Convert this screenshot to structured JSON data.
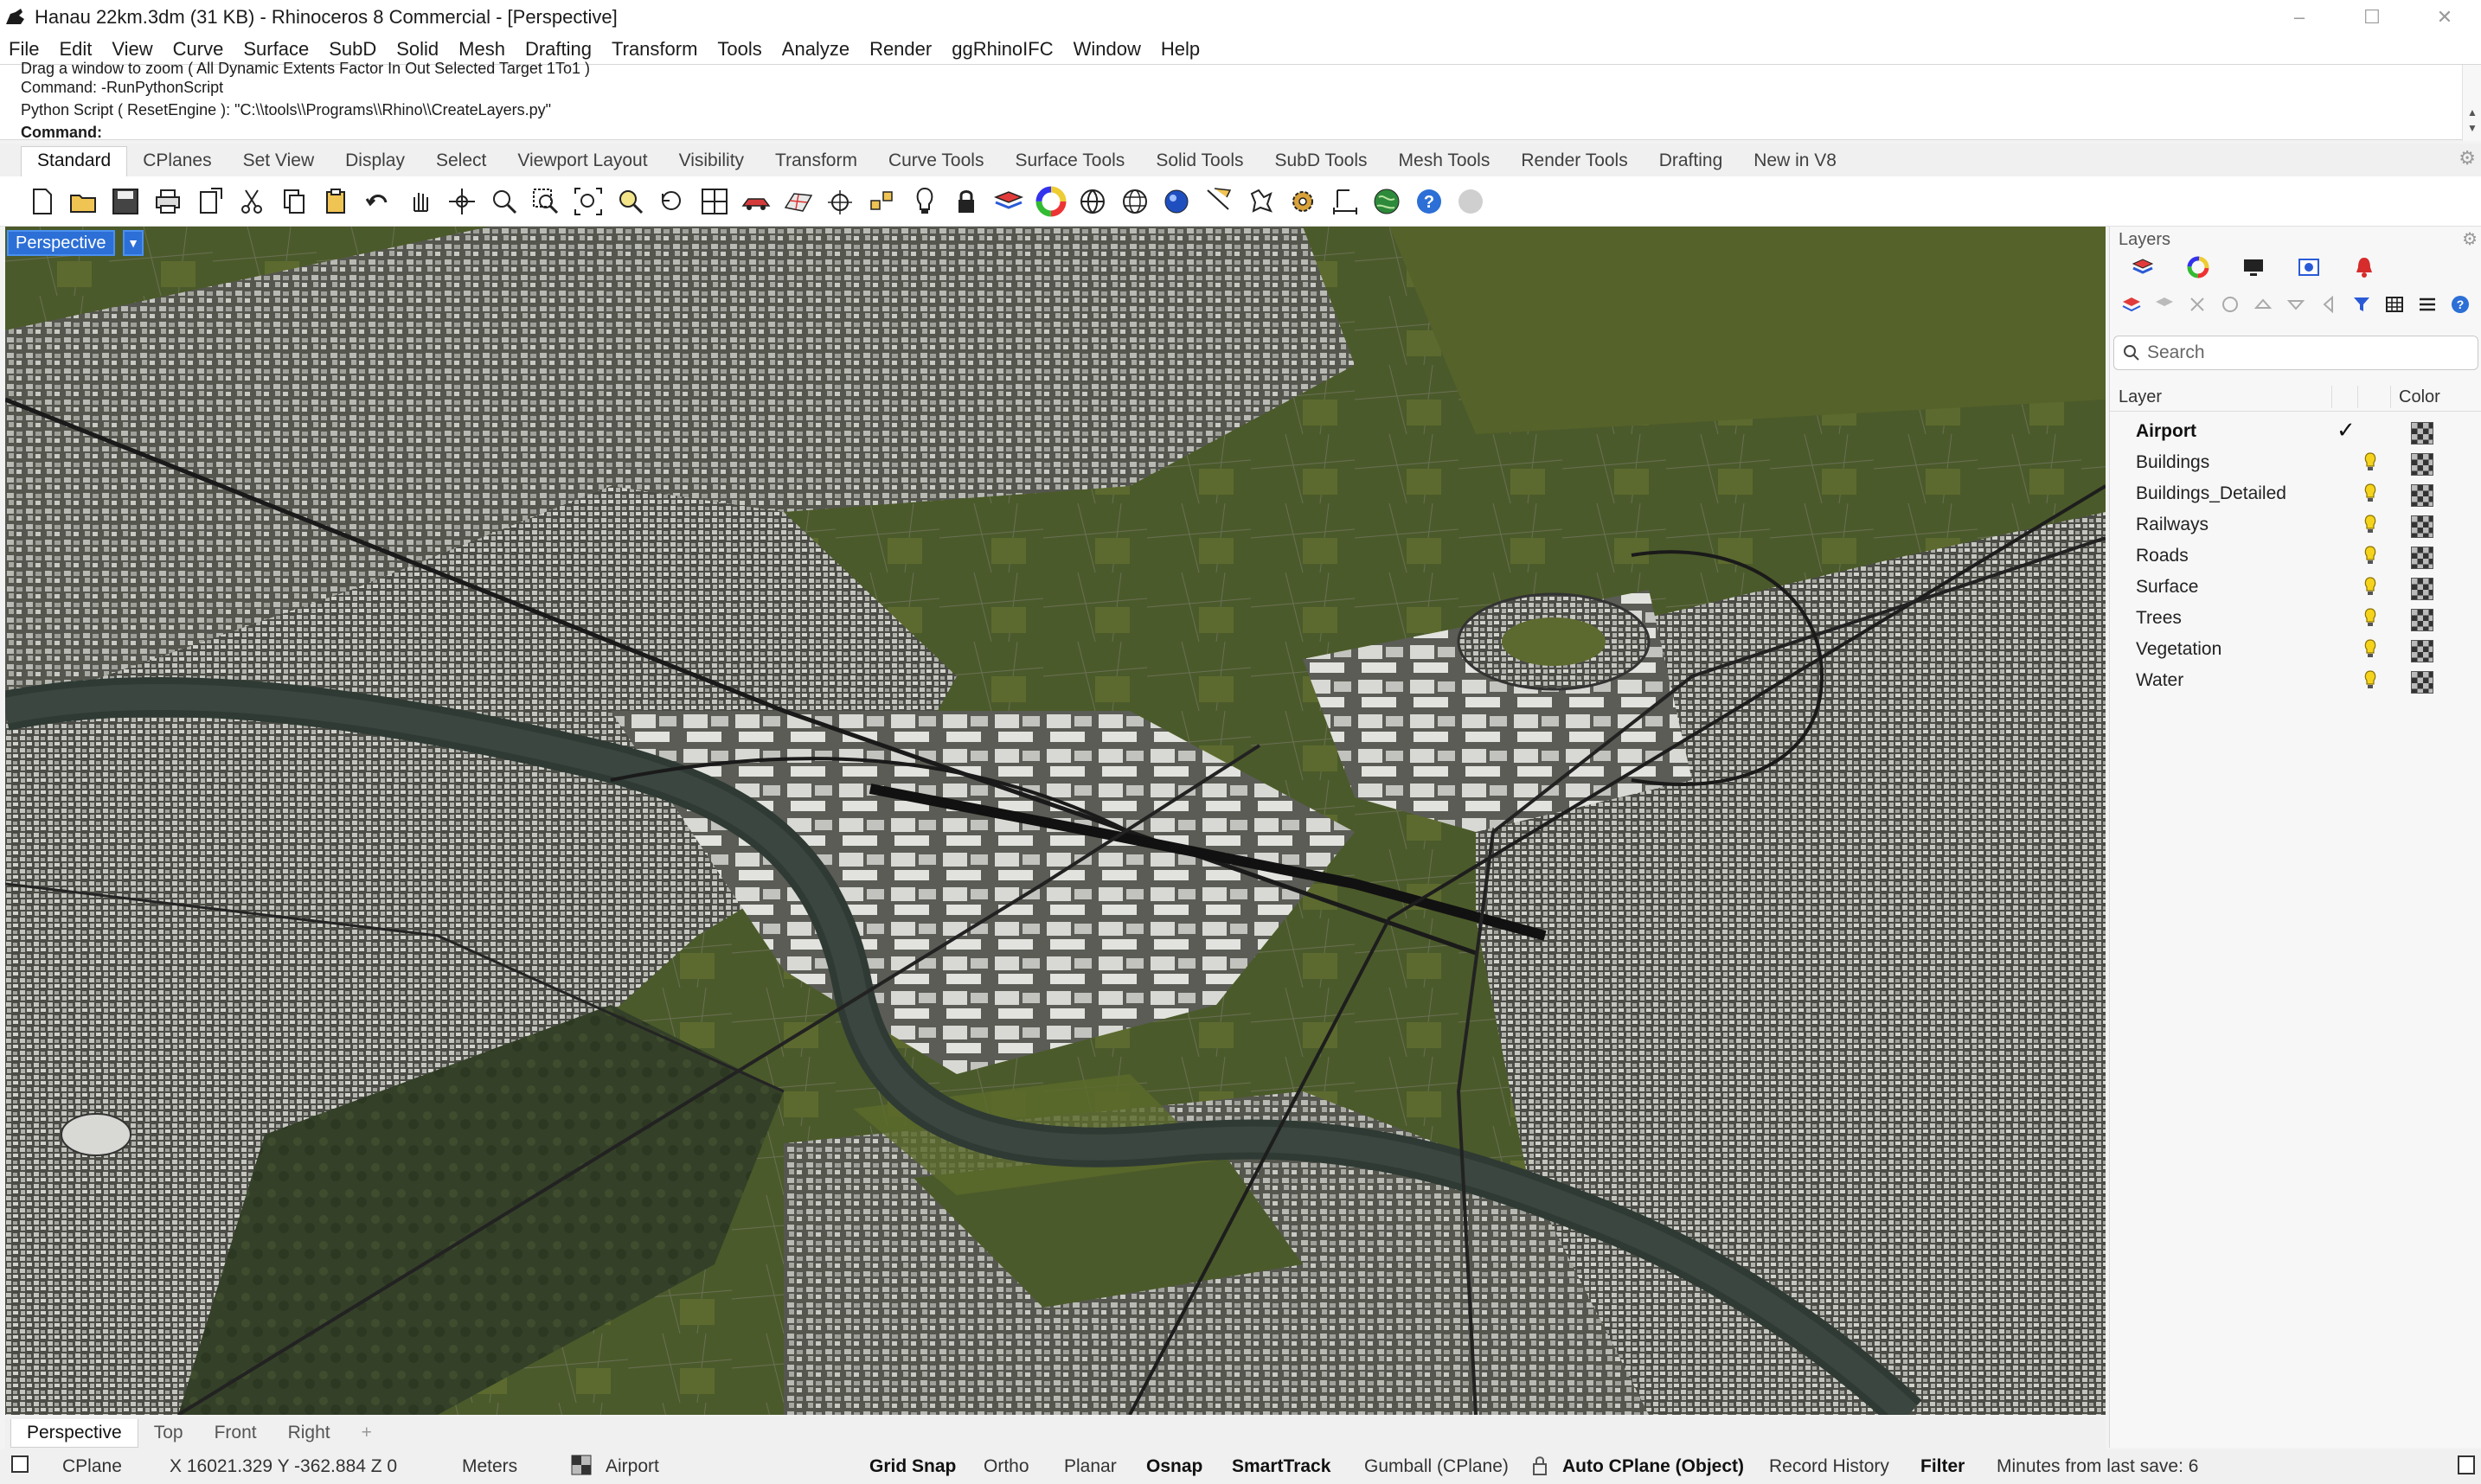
{
  "window": {
    "title": "Hanau 22km.3dm (31 KB) - Rhinoceros 8 Commercial - [Perspective]",
    "controls": [
      "–",
      "☐",
      "✕"
    ]
  },
  "menu": [
    "File",
    "Edit",
    "View",
    "Curve",
    "Surface",
    "SubD",
    "Solid",
    "Mesh",
    "Drafting",
    "Transform",
    "Tools",
    "Analyze",
    "Render",
    "ggRhinoIFC",
    "Window",
    "Help"
  ],
  "command": {
    "history": [
      "Drag a window to zoom ( All  Dynamic  Extents  Factor  In  Out  Selected  Target  1To1 )",
      "Command: -RunPythonScript",
      "Python Script ( ResetEngine ): \"C:\\\\tools\\\\Programs\\\\Rhino\\\\CreateLayers.py\""
    ],
    "prompt": "Command:"
  },
  "toolbar_tabs": [
    "Standard",
    "CPlanes",
    "Set View",
    "Display",
    "Select",
    "Viewport Layout",
    "Visibility",
    "Transform",
    "Curve Tools",
    "Surface Tools",
    "Solid Tools",
    "SubD Tools",
    "Mesh Tools",
    "Render Tools",
    "Drafting",
    "New in V8"
  ],
  "toolbar_active": "Standard",
  "tools": [
    "new-icon",
    "open-icon",
    "save-icon",
    "print-icon",
    "import-icon",
    "cut-icon",
    "copy-icon",
    "paste-icon",
    "undo-icon",
    "pan-icon",
    "rotate-view-icon",
    "zoom-icon",
    "zoom-window-icon",
    "zoom-extents-icon",
    "zoom-selected-icon",
    "undo-view-icon",
    "viewport-layout-icon",
    "named-views-icon",
    "cplane-icon",
    "set-cplane-icon",
    "object-snap-icon",
    "light-icon",
    "lock-icon",
    "layer-icon",
    "color-wheel-icon",
    "shaded-icon",
    "wireframe-icon",
    "rendered-icon",
    "flat-shade-icon",
    "lasso-icon",
    "options-gear-icon",
    "dimension-icon",
    "globe-icon",
    "help-icon",
    "more-icon"
  ],
  "viewport": {
    "label": "Perspective",
    "tabs": [
      "Perspective",
      "Top",
      "Front",
      "Right"
    ],
    "active_tab": "Perspective",
    "add_tab": "+"
  },
  "layers_panel": {
    "title": "Layers",
    "search_placeholder": "Search",
    "col_layer": "Layer",
    "col_color": "Color",
    "layers": [
      {
        "name": "Airport",
        "current": true
      },
      {
        "name": "Buildings",
        "current": false
      },
      {
        "name": "Buildings_Detailed",
        "current": false
      },
      {
        "name": "Railways",
        "current": false
      },
      {
        "name": "Roads",
        "current": false
      },
      {
        "name": "Surface",
        "current": false
      },
      {
        "name": "Trees",
        "current": false
      },
      {
        "name": "Vegetation",
        "current": false
      },
      {
        "name": "Water",
        "current": false
      }
    ]
  },
  "status": {
    "cplane": "CPlane",
    "coords": "X 16021.329 Y -362.884 Z 0",
    "units": "Meters",
    "layer": "Airport",
    "grid_snap": "Grid Snap",
    "ortho": "Ortho",
    "planar": "Planar",
    "osnap": "Osnap",
    "smarttrack": "SmartTrack",
    "gumball": "Gumball (CPlane)",
    "auto_cplane": "Auto CPlane (Object)",
    "record_history": "Record History",
    "filter": "Filter",
    "last_save": "Minutes from last save: 6"
  },
  "colors": {
    "accent": "#2c6fd6",
    "river": "#2f3a34",
    "fields": "#4e5a2e",
    "urban": "#6d6e6a"
  }
}
